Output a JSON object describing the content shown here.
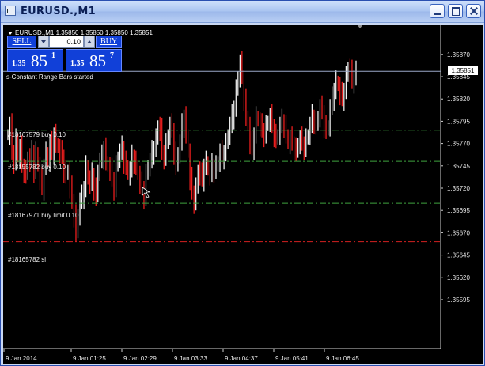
{
  "window": {
    "title": "EURUSD.,M1"
  },
  "chart_header": {
    "symbol_info": "EURUSD.,M1  1.35850 1.35850 1.35850 1.35851"
  },
  "trade_panel": {
    "sell_label": "SELL",
    "buy_label": "BUY",
    "lot_value": "0.10",
    "sell_price_prefix": "1.35",
    "sell_price_big": "85",
    "sell_price_sup": "1",
    "buy_price_prefix": "1.35",
    "buy_price_big": "85",
    "buy_price_sup": "7"
  },
  "status_text": "s-Constant Range Bars started",
  "orders": [
    {
      "label": "#18167579 buy 0.10",
      "price": 1.35785,
      "color": "#3fa33f",
      "style": "dashdot"
    },
    {
      "label": "#18155782 buy 0.10",
      "price": 1.3575,
      "color": "#3fa33f",
      "style": "dashdot"
    },
    {
      "label": "#18167971 buy limit 0.10",
      "price": 1.35703,
      "color": "#3fa33f",
      "style": "dashdot"
    },
    {
      "label": "#18165782 sl",
      "price": 1.3566,
      "color": "#d42020",
      "style": "dashdot"
    }
  ],
  "current_price": {
    "label": "1.35851",
    "value": 1.35851,
    "color": "#9aa8c8"
  },
  "chart_data": {
    "type": "bar",
    "title": "EURUSD.,M1",
    "ylim": [
      1.3554,
      1.359
    ],
    "y_ticks": [
      "1.35870",
      "1.35845",
      "1.35820",
      "1.35795",
      "1.35770",
      "1.35745",
      "1.35720",
      "1.35695",
      "1.35670",
      "1.35645",
      "1.35620",
      "1.35595"
    ],
    "x_ticks": [
      "9 Jan 2014",
      "9 Jan 01:25",
      "9 Jan 02:29",
      "9 Jan 03:33",
      "9 Jan 04:37",
      "9 Jan 05:41",
      "9 Jan 06:45"
    ],
    "bar_color_up": "#ffffff",
    "bar_color_down": "#ff2020",
    "close_series": [
      1.3578,
      1.3579,
      1.3576,
      1.3575,
      1.35775,
      1.35755,
      1.35765,
      1.35745,
      1.3574,
      1.35735,
      1.35755,
      1.3575,
      1.3576,
      1.3574,
      1.3576,
      1.35745,
      1.3573,
      1.3572,
      1.35745,
      1.3576,
      1.3575,
      1.3577,
      1.3576,
      1.3578,
      1.3577,
      1.35765,
      1.3576,
      1.35755,
      1.3574,
      1.35735,
      1.3574,
      1.3572,
      1.35705,
      1.3569,
      1.3567,
      1.3569,
      1.35705,
      1.3571,
      1.3572,
      1.35745,
      1.3573,
      1.35725,
      1.35735,
      1.3572,
      1.3571,
      1.3574,
      1.3575,
      1.35755,
      1.35765,
      1.3575,
      1.35745,
      1.3574,
      1.3573,
      1.3572,
      1.35745,
      1.35755,
      1.3576,
      1.35765,
      1.3575,
      1.35745,
      1.35735,
      1.3574,
      1.35755,
      1.3575,
      1.35745,
      1.35735,
      1.35725,
      1.3572,
      1.3571,
      1.35735,
      1.35745,
      1.3575,
      1.3576,
      1.35765,
      1.35775,
      1.3579,
      1.35785,
      1.3576,
      1.35755,
      1.3577,
      1.3578,
      1.3579,
      1.35785,
      1.3576,
      1.35745,
      1.3576,
      1.3577,
      1.3579,
      1.358,
      1.3578,
      1.3576,
      1.3573,
      1.35715,
      1.35705,
      1.3572,
      1.3574,
      1.35735,
      1.3573,
      1.35745,
      1.3575,
      1.3574,
      1.35735,
      1.35745,
      1.3574,
      1.35745,
      1.3575,
      1.3576,
      1.35755,
      1.3576,
      1.3577,
      1.3578,
      1.3579,
      1.358,
      1.3581,
      1.3583,
      1.35845,
      1.3586,
      1.35845,
      1.3582,
      1.358,
      1.3579,
      1.3577,
      1.35765,
      1.3578,
      1.358,
      1.35795,
      1.3579,
      1.35785,
      1.3578,
      1.3579,
      1.35795,
      1.358,
      1.3579,
      1.3578,
      1.35775,
      1.3578,
      1.3579,
      1.35795,
      1.3579,
      1.3578,
      1.3577,
      1.35775,
      1.3577,
      1.35765,
      1.3576,
      1.3577,
      1.35775,
      1.3577,
      1.35765,
      1.35775,
      1.3578,
      1.3579,
      1.358,
      1.35795,
      1.3579,
      1.358,
      1.3581,
      1.35805,
      1.3579,
      1.35785,
      1.3579,
      1.3581,
      1.3582,
      1.3583,
      1.3584,
      1.35835,
      1.35825,
      1.3582,
      1.3583,
      1.35845,
      1.35855,
      1.3585,
      1.3584,
      1.35845,
      1.35851
    ]
  }
}
